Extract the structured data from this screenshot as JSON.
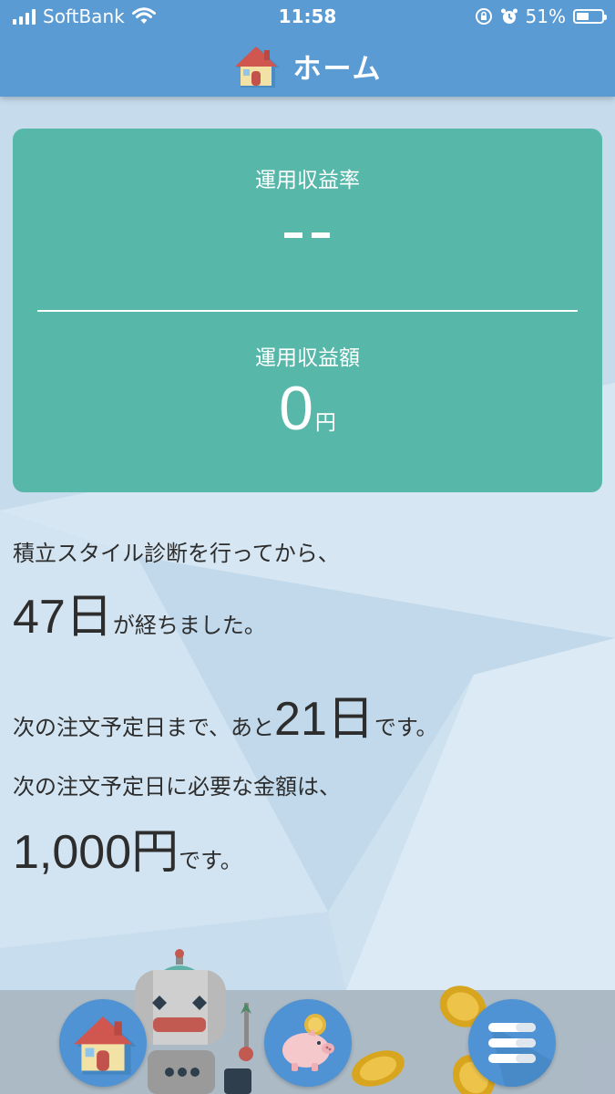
{
  "status_bar": {
    "carrier": "SoftBank",
    "time": "11:58",
    "battery_percent": "51%",
    "battery_level": 0.51
  },
  "header": {
    "title": "ホーム",
    "icon": "house-icon"
  },
  "card": {
    "rate_label": "運用収益率",
    "rate_value": "--",
    "amount_label": "運用収益額",
    "amount_value": "0",
    "amount_unit": "円",
    "color": "#57b8aa"
  },
  "info": {
    "diagnosis_line": "積立スタイル診断を行ってから、",
    "days_elapsed": "47日",
    "days_elapsed_suffix": "が経ちました。",
    "next_order_prefix": "次の注文予定日まで、あと",
    "next_order_days": "21日",
    "next_order_suffix": "です。",
    "required_amount_line": "次の注文予定日に必要な金額は、",
    "required_amount": "1,000円",
    "required_amount_suffix": "です。"
  },
  "bottom_nav": {
    "items": [
      {
        "icon": "house-icon"
      },
      {
        "icon": "piggy-bank-icon"
      },
      {
        "icon": "menu-icon"
      }
    ]
  },
  "colors": {
    "header": "#5a9bd4",
    "card": "#57b8aa",
    "nav_button": "#4f93d4"
  }
}
